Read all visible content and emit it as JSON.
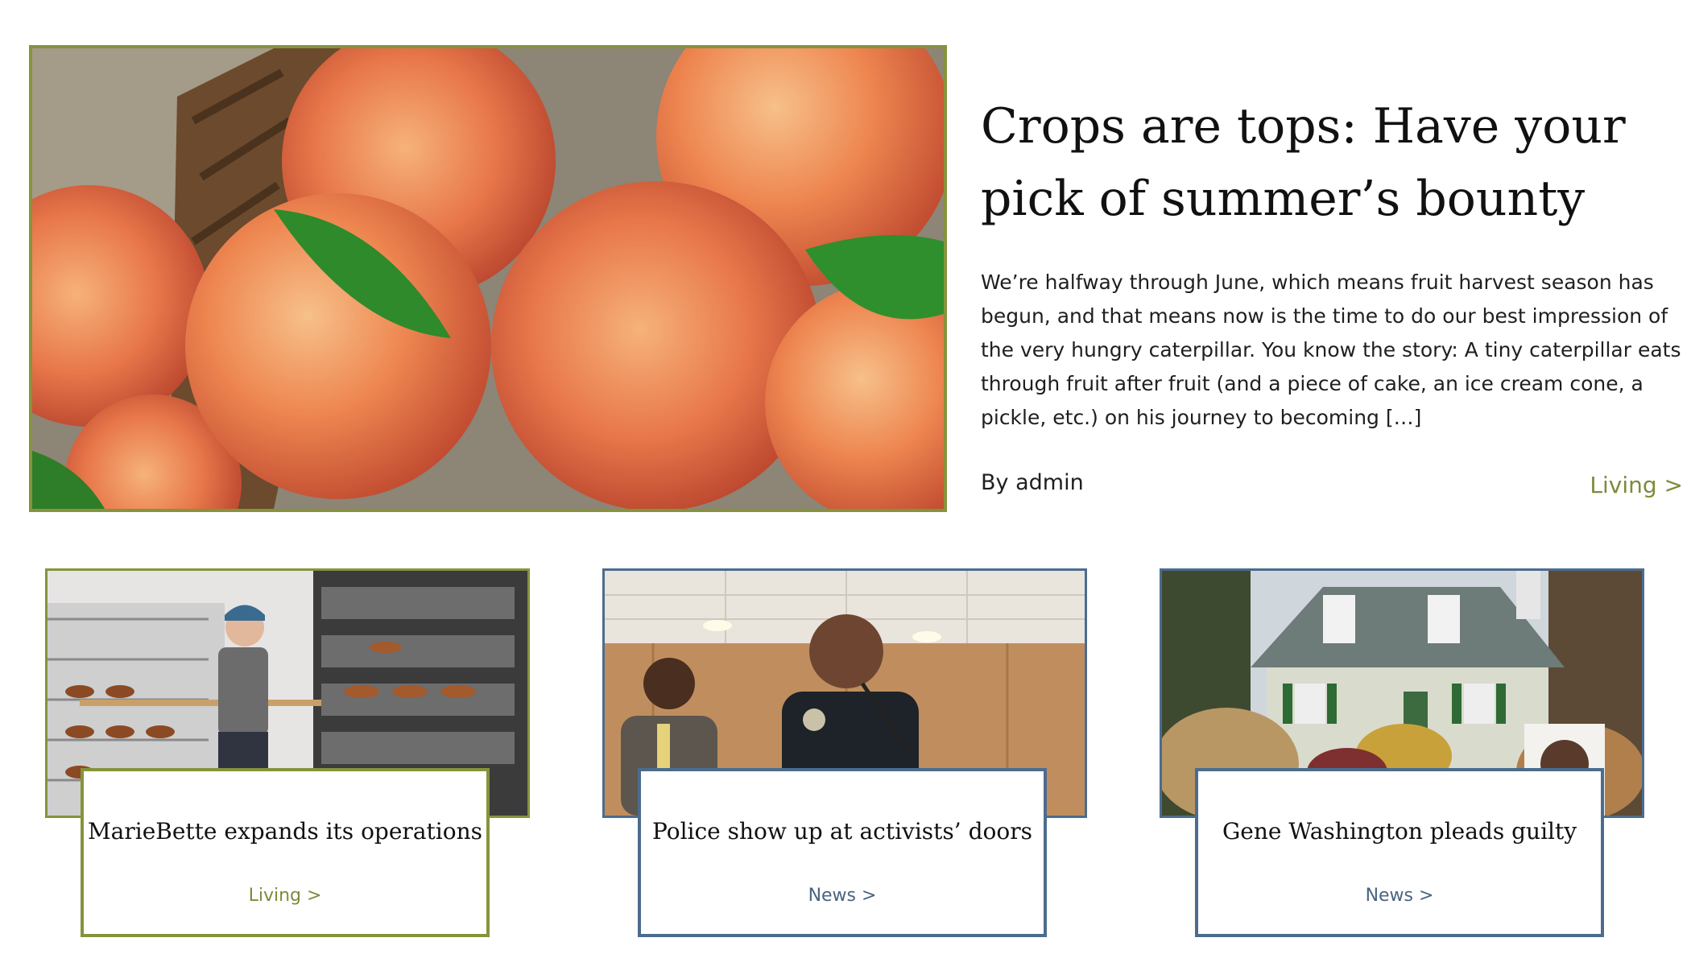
{
  "feature": {
    "title": "Crops are tops: Have your pick of summer’s bounty",
    "excerpt": "We’re halfway through June, which means fruit harvest season has begun, and that means now is the time to do our best impression of the very hungry caterpillar. You know the story: A tiny caterpillar eats through fruit after fruit (and a piece of cake, an ice cream cone, a pickle, etc.) on his journey to becoming […]",
    "byline_prefix": "By",
    "author": "admin",
    "category": "Living >",
    "image": "peaches-in-basket-photo"
  },
  "cards": [
    {
      "title": "MarieBette expands its operations",
      "category": "Living >",
      "image": "bakery-oven-photo"
    },
    {
      "title": "Police show up at activists’ doors",
      "category": "News >",
      "image": "police-chief-press-conference-photo"
    },
    {
      "title": "Gene Washington pleads guilty",
      "category": "News >",
      "image": "house-with-mugshot-photo"
    }
  ],
  "colors": {
    "living": "#86933c",
    "news": "#4c6c8e"
  }
}
